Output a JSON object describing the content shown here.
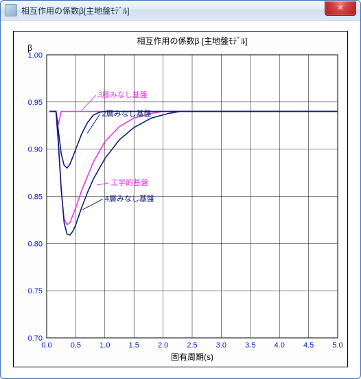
{
  "window": {
    "title": "相互作用の係数β[主地盤ﾓﾃﾞﾙ]",
    "close_icon": "×"
  },
  "chart_data": {
    "type": "line",
    "title": "相互作用の係数β [主地盤ﾓﾃﾞﾙ]",
    "xlabel": "固有周期(s)",
    "ylabel": "β",
    "xlim": [
      0.0,
      5.0
    ],
    "ylim": [
      0.7,
      1.0
    ],
    "xticks": [
      0.0,
      0.5,
      1.0,
      1.5,
      2.0,
      2.5,
      3.0,
      3.5,
      4.0,
      4.5,
      5.0
    ],
    "yticks": [
      0.7,
      0.75,
      0.8,
      0.85,
      0.9,
      0.95,
      1.0
    ],
    "series": [
      {
        "name": "3層みなし基盤",
        "color": "magenta",
        "label_at": [
          0.88,
          0.955
        ],
        "arrow_to": [
          0.6,
          0.941
        ],
        "data": [
          [
            0.05,
            0.94
          ],
          [
            0.16,
            0.94
          ],
          [
            0.2,
            0.926
          ],
          [
            0.25,
            0.94
          ],
          [
            5.0,
            0.94
          ]
        ]
      },
      {
        "name": "工学的基盤",
        "color": "magenta",
        "label_at": [
          1.1,
          0.862
        ],
        "arrow_to": [
          0.86,
          0.862
        ],
        "data": [
          [
            0.05,
            0.94
          ],
          [
            0.16,
            0.94
          ],
          [
            0.2,
            0.905
          ],
          [
            0.25,
            0.856
          ],
          [
            0.3,
            0.826
          ],
          [
            0.35,
            0.82
          ],
          [
            0.4,
            0.822
          ],
          [
            0.5,
            0.838
          ],
          [
            0.6,
            0.856
          ],
          [
            0.8,
            0.886
          ],
          [
            1.0,
            0.908
          ],
          [
            1.25,
            0.924
          ],
          [
            1.5,
            0.933
          ],
          [
            1.8,
            0.938
          ],
          [
            2.0,
            0.94
          ],
          [
            5.0,
            0.94
          ]
        ]
      },
      {
        "name": "2層みなし基盤",
        "color": "navy",
        "label_at": [
          0.95,
          0.935
        ],
        "arrow_to": [
          0.7,
          0.917
        ],
        "data": [
          [
            0.05,
            0.94
          ],
          [
            0.16,
            0.94
          ],
          [
            0.2,
            0.92
          ],
          [
            0.25,
            0.895
          ],
          [
            0.3,
            0.883
          ],
          [
            0.35,
            0.88
          ],
          [
            0.4,
            0.884
          ],
          [
            0.5,
            0.9
          ],
          [
            0.6,
            0.916
          ],
          [
            0.7,
            0.928
          ],
          [
            0.8,
            0.936
          ],
          [
            0.9,
            0.939
          ],
          [
            1.0,
            0.94
          ],
          [
            5.0,
            0.94
          ]
        ]
      },
      {
        "name": "4層みなし基盤",
        "color": "navy",
        "label_at": [
          1.0,
          0.845
        ],
        "arrow_to": [
          0.62,
          0.836
        ],
        "data": [
          [
            0.05,
            0.94
          ],
          [
            0.16,
            0.94
          ],
          [
            0.2,
            0.908
          ],
          [
            0.25,
            0.858
          ],
          [
            0.3,
            0.822
          ],
          [
            0.35,
            0.81
          ],
          [
            0.4,
            0.809
          ],
          [
            0.45,
            0.813
          ],
          [
            0.5,
            0.82
          ],
          [
            0.6,
            0.838
          ],
          [
            0.7,
            0.854
          ],
          [
            0.8,
            0.868
          ],
          [
            1.0,
            0.89
          ],
          [
            1.25,
            0.91
          ],
          [
            1.5,
            0.923
          ],
          [
            1.8,
            0.933
          ],
          [
            2.1,
            0.938
          ],
          [
            2.3,
            0.94
          ],
          [
            5.0,
            0.94
          ]
        ]
      }
    ]
  }
}
